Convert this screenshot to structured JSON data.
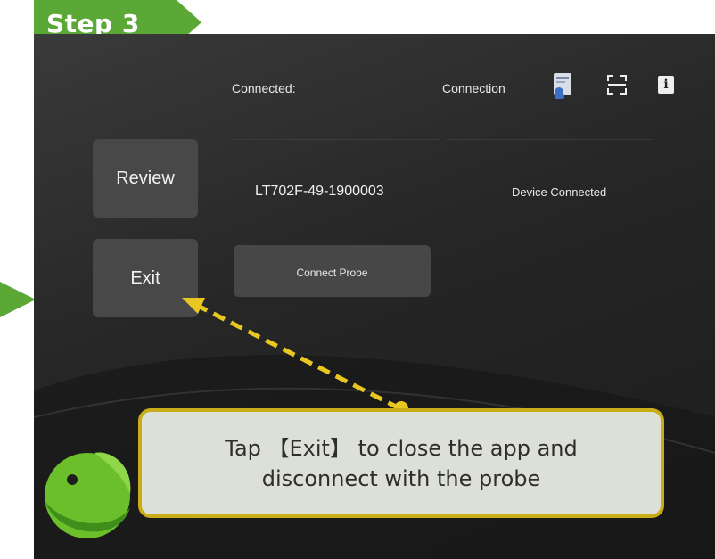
{
  "banner": {
    "step_label": "Step 3",
    "color": "#5ca837"
  },
  "header": {
    "connected_label": "Connected:",
    "connection_label": "Connection",
    "icons": [
      "manual-icon",
      "scan-icon",
      "info-icon"
    ],
    "info_glyph": "i"
  },
  "sidebar": {
    "review_label": "Review",
    "exit_label": "Exit"
  },
  "device": {
    "id": "LT702F-49-1900003",
    "status": "Device Connected"
  },
  "actions": {
    "connect_probe_label": "Connect Probe"
  },
  "callout": {
    "line1": "Tap 【Exit】 to close the app and",
    "line2": "disconnect with the probe",
    "border_color": "#c8ad18",
    "background": "#dde0d6"
  },
  "colors": {
    "accent_green": "#5ca837",
    "screen_background": "#262626",
    "button_gray": "#484848"
  }
}
